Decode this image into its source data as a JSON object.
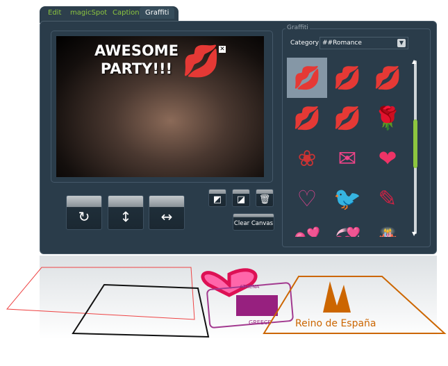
{
  "tabs": [
    {
      "label": "Edit"
    },
    {
      "label": "magicSpot"
    },
    {
      "label": "Caption"
    },
    {
      "label": "Graffiti",
      "active": true
    }
  ],
  "canvas": {
    "text_line1": "AWESOME",
    "text_line2": "PARTY!!!"
  },
  "buttons": {
    "rotate": "rotate-icon",
    "flip_vertical": "flip-vertical-icon",
    "flip_horizontal": "flip-horizontal-icon",
    "bring_front": "bring-front-icon",
    "send_back": "send-back-icon",
    "delete": "trash-icon",
    "clear_canvas": "Clear Canvas"
  },
  "panel": {
    "legend": "Graffiti",
    "category_label": "Category",
    "category_value": "##Romance"
  },
  "graffiti": [
    {
      "name": "red-lips",
      "glyph": "💋",
      "color": "#e00"
    },
    {
      "name": "red-lips-2",
      "glyph": "💋",
      "color": "#e00"
    },
    {
      "name": "magenta-lips",
      "glyph": "💋",
      "color": "#c3c"
    },
    {
      "name": "green-lips",
      "glyph": "💋",
      "color": "#7c2"
    },
    {
      "name": "purple-lips",
      "glyph": "💋",
      "color": "#63c"
    },
    {
      "name": "rose",
      "glyph": "🌹",
      "color": "#c22"
    },
    {
      "name": "rose-bloom",
      "glyph": "❀",
      "color": "#c33"
    },
    {
      "name": "love-letter",
      "glyph": "✉",
      "color": "#e48"
    },
    {
      "name": "winged-heart",
      "glyph": "❤",
      "color": "#e36"
    },
    {
      "name": "kiss-me-heart",
      "glyph": "♡",
      "color": "#c48"
    },
    {
      "name": "love-birds",
      "glyph": "🐦",
      "color": "#e6a"
    },
    {
      "name": "love-card",
      "glyph": "✎",
      "color": "#c24"
    },
    {
      "name": "hearts",
      "glyph": "💕",
      "color": "#e4a"
    },
    {
      "name": "hearts-cluster",
      "glyph": "💞",
      "color": "#d26"
    },
    {
      "name": "cake",
      "glyph": "🎂",
      "color": "#e48"
    }
  ],
  "stamps": {
    "athens_top": "ATHENA",
    "athens_bottom": "GREECE",
    "spain": "Reino de España"
  }
}
